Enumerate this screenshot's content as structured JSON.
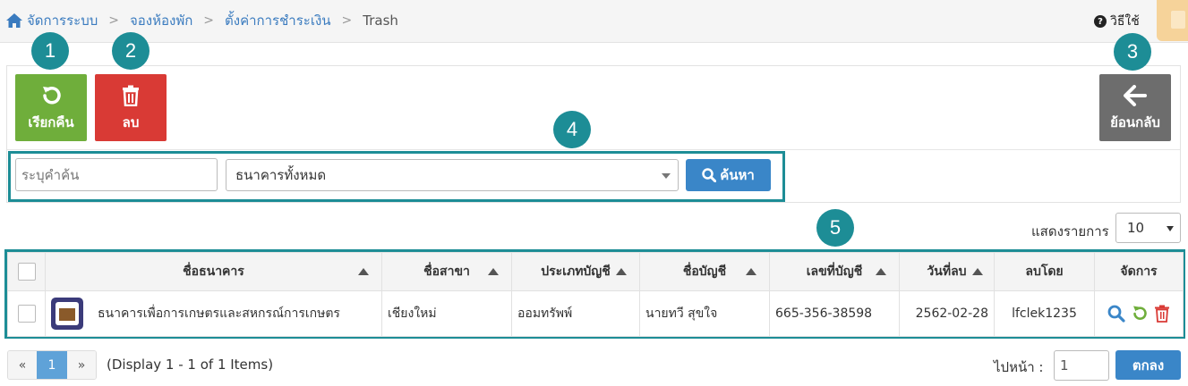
{
  "breadcrumb": {
    "items": [
      "จัดการระบบ",
      "จองห้องพัก",
      "ตั้งค่าการชำระเงิน",
      "Trash"
    ],
    "separator": ">"
  },
  "help": {
    "label": "วิธีใช้",
    "icon": "question-circle-icon"
  },
  "toolbar": {
    "restore_label": "เรียกคืน",
    "delete_label": "ลบ",
    "back_label": "ย้อนกลับ"
  },
  "badges": [
    "1",
    "2",
    "3",
    "4",
    "5"
  ],
  "search": {
    "placeholder": "ระบุคำค้น",
    "value": "",
    "bank_filter": "ธนาคารทั้งหมด",
    "button_label": "ค้นหา"
  },
  "page_size": {
    "label": "แสดงรายการ",
    "value": "10"
  },
  "table": {
    "columns": [
      "ชื่อธนาคาร",
      "ชื่อสาขา",
      "ประเภทบัญชี",
      "ชื่อบัญชี",
      "เลขที่บัญชี",
      "วันที่ลบ",
      "ลบโดย",
      "จัดการ"
    ],
    "rows": [
      {
        "bank": "ธนาคารเพื่อการเกษตรและสหกรณ์การเกษตร",
        "branch": "เชียงใหม่",
        "account_type": "ออมทรัพพ์",
        "account_name": "นายทวี สุขใจ",
        "account_no": "665-356-38598",
        "deleted_date": "2562-02-28",
        "deleted_by": "lfclek1235"
      }
    ]
  },
  "pagination": {
    "prev": "«",
    "current": "1",
    "next": "»",
    "info": "(Display 1 - 1 of 1 Items)",
    "goto_label": "ไปหน้า :",
    "goto_value": "1",
    "goto_button": "ตกลง"
  },
  "colors": {
    "accent": "#1d8d96",
    "restore": "#6fae3b",
    "delete": "#d93a35",
    "back": "#6d6d6d",
    "primary": "#3a86c8"
  }
}
